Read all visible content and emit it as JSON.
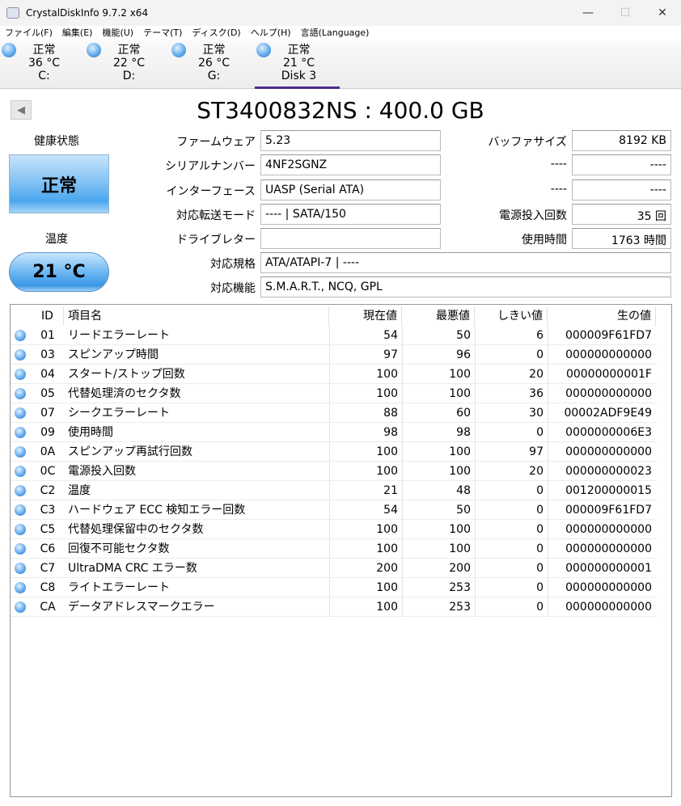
{
  "window": {
    "title": "CrystalDiskInfo 9.7.2 x64",
    "minimize": "—",
    "maximize": "☐",
    "close": "✕"
  },
  "menu": [
    "ファイル(F)",
    "編集(E)",
    "機能(U)",
    "テーマ(T)",
    "ディスク(D)",
    "ヘルプ(H)",
    "言語(Language)"
  ],
  "disks": [
    {
      "status": "正常",
      "temp": "36 °C",
      "name": "C:"
    },
    {
      "status": "正常",
      "temp": "22 °C",
      "name": "D:"
    },
    {
      "status": "正常",
      "temp": "26 °C",
      "name": "G:"
    },
    {
      "status": "正常",
      "temp": "21 °C",
      "name": "Disk 3"
    }
  ],
  "model": "ST3400832NS : 400.0 GB",
  "health": {
    "label": "健康状態",
    "value": "正常"
  },
  "temperature": {
    "label": "温度",
    "value": "21 °C"
  },
  "info": {
    "firmware_label": "ファームウェア",
    "firmware": "5.23",
    "serial_label": "シリアルナンバー",
    "serial": "4NF2SGNZ",
    "interface_label": "インターフェース",
    "interface": "UASP (Serial ATA)",
    "transfer_label": "対応転送モード",
    "transfer": "---- | SATA/150",
    "drive_letter_label": "ドライブレター",
    "drive_letter": "",
    "standard_label": "対応規格",
    "standard": "ATA/ATAPI-7 | ----",
    "features_label": "対応機能",
    "features": "S.M.A.R.T., NCQ, GPL",
    "buffer_label": "バッファサイズ",
    "buffer": "8192 KB",
    "blank1_label": "----",
    "blank1": "----",
    "blank2_label": "----",
    "blank2": "----",
    "power_count_label": "電源投入回数",
    "power_count": "35 回",
    "hours_label": "使用時間",
    "hours": "1763 時間"
  },
  "smart": {
    "headers": [
      "ID",
      "項目名",
      "現在値",
      "最悪値",
      "しきい値",
      "生の値"
    ],
    "rows": [
      [
        "01",
        "リードエラーレート",
        "54",
        "50",
        "6",
        "000009F61FD7"
      ],
      [
        "03",
        "スピンアップ時間",
        "97",
        "96",
        "0",
        "000000000000"
      ],
      [
        "04",
        "スタート/ストップ回数",
        "100",
        "100",
        "20",
        "00000000001F"
      ],
      [
        "05",
        "代替処理済のセクタ数",
        "100",
        "100",
        "36",
        "000000000000"
      ],
      [
        "07",
        "シークエラーレート",
        "88",
        "60",
        "30",
        "00002ADF9E49"
      ],
      [
        "09",
        "使用時間",
        "98",
        "98",
        "0",
        "0000000006E3"
      ],
      [
        "0A",
        "スピンアップ再試行回数",
        "100",
        "100",
        "97",
        "000000000000"
      ],
      [
        "0C",
        "電源投入回数",
        "100",
        "100",
        "20",
        "000000000023"
      ],
      [
        "C2",
        "温度",
        "21",
        "48",
        "0",
        "001200000015"
      ],
      [
        "C3",
        "ハードウェア ECC 検知エラー回数",
        "54",
        "50",
        "0",
        "000009F61FD7"
      ],
      [
        "C5",
        "代替処理保留中のセクタ数",
        "100",
        "100",
        "0",
        "000000000000"
      ],
      [
        "C6",
        "回復不可能セクタ数",
        "100",
        "100",
        "0",
        "000000000000"
      ],
      [
        "C7",
        "UltraDMA CRC エラー数",
        "200",
        "200",
        "0",
        "000000000001"
      ],
      [
        "C8",
        "ライトエラーレート",
        "100",
        "253",
        "0",
        "000000000000"
      ],
      [
        "CA",
        "データアドレスマークエラー",
        "100",
        "253",
        "0",
        "000000000000"
      ]
    ]
  }
}
